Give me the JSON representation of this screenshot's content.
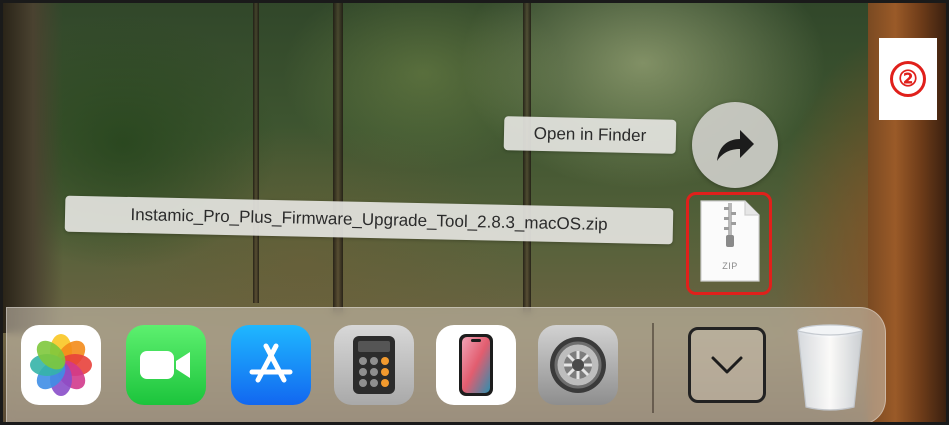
{
  "step_badge": {
    "label": "②"
  },
  "download_popup": {
    "open_in_finder_label": "Open in Finder",
    "filename": "Instamic_Pro_Plus_Firmware_Upgrade_Tool_2.8.3_macOS.zip",
    "file_type_label": "ZIP"
  },
  "dock": {
    "apps": [
      {
        "icon": "photos-icon"
      },
      {
        "icon": "facetime-icon"
      },
      {
        "icon": "app-store-icon"
      },
      {
        "icon": "calculator-icon"
      },
      {
        "icon": "iphone-mirroring-icon"
      },
      {
        "icon": "system-settings-icon"
      }
    ],
    "downloads_stack_icon": "chevron-down-icon",
    "trash_icon": "trash-icon"
  },
  "colors": {
    "highlight_red": "#e0201b",
    "pill_background": "#e4e4e0",
    "dock_background": "#d2c8b9"
  }
}
